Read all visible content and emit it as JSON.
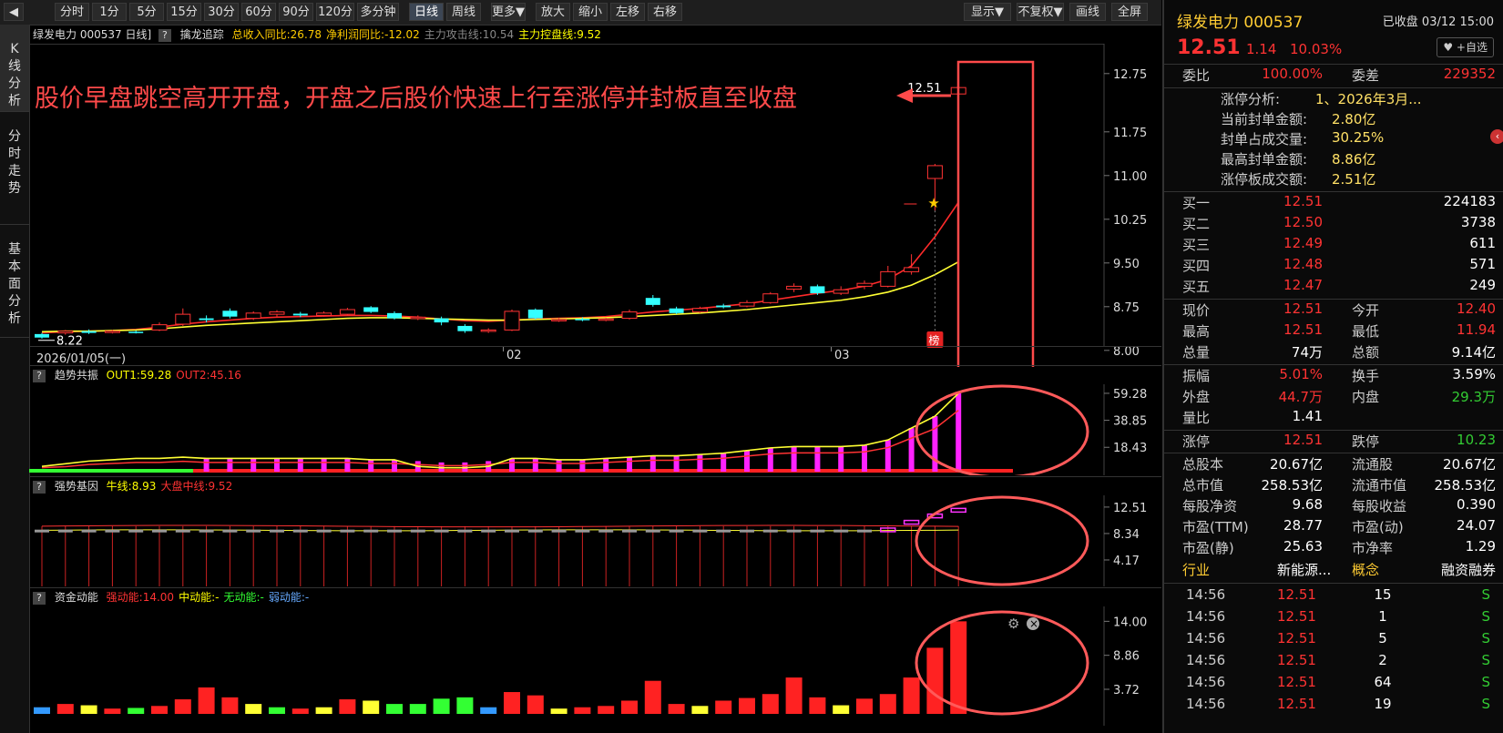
{
  "toolbar": {
    "collapse_label": "◀",
    "buttons": [
      "分时",
      "1分",
      "5分",
      "15分",
      "30分",
      "60分",
      "90分",
      "120分",
      "多分钟",
      "日线",
      "周线",
      "更多▼",
      "放大",
      "缩小",
      "左移",
      "右移"
    ],
    "active": "日线",
    "right_buttons": [
      "显示▼",
      "不复权▼",
      "画线",
      "全屏"
    ]
  },
  "left_tabs": [
    "K线分析",
    "分时走势",
    "基本面分析"
  ],
  "main_chart": {
    "title": "绿发电力 000537 日线]",
    "indicator_name": "擒龙追踪",
    "stats": [
      {
        "text": "总收入同比:26.78",
        "color": "#ffcc00"
      },
      {
        "text": "净利润同比:-12.02",
        "color": "#ffcc00"
      },
      {
        "text": "主力攻击线:10.54",
        "color": "#888888"
      },
      {
        "text": "主力控盘线:9.52",
        "color": "#ffff00"
      }
    ],
    "annotation": "股价早盘跳空高开开盘，开盘之后股价快速上行至涨停并封板直至收盘",
    "y_ticks": [
      "12.75",
      "11.75",
      "11.00",
      "10.25",
      "9.50",
      "8.75",
      "8.00"
    ],
    "date_labels": [
      "2026/01/05(一)",
      "02",
      "03"
    ],
    "low_label": "8.22",
    "high_label": "12.51",
    "badge": "榜"
  },
  "panel1": {
    "name": "趋势共振",
    "vals": [
      {
        "text": "OUT1:59.28",
        "color": "#ffff00"
      },
      {
        "text": "OUT2:45.16",
        "color": "#ff3333"
      }
    ],
    "y_ticks": [
      "59.28",
      "38.85",
      "18.43"
    ]
  },
  "panel2": {
    "name": "强势基因",
    "vals": [
      {
        "text": "牛线:8.93",
        "color": "#ffff00"
      },
      {
        "text": "大盘中线:9.52",
        "color": "#ff3333"
      }
    ],
    "y_ticks": [
      "12.51",
      "8.34",
      "4.17"
    ]
  },
  "panel3": {
    "name": "资金动能",
    "vals": [
      {
        "text": "强动能:14.00",
        "color": "#ff3333"
      },
      {
        "text": "中动能:-",
        "color": "#ffff00"
      },
      {
        "text": "无动能:-",
        "color": "#33ff33"
      },
      {
        "text": "弱动能:-",
        "color": "#66aaff"
      }
    ],
    "y_ticks": [
      "14.00",
      "8.86",
      "3.72"
    ]
  },
  "chart_data": {
    "type": "candlestick",
    "title": "绿发电力 000537 日线",
    "ylim": [
      8.0,
      12.9
    ],
    "candles": [
      {
        "o": 8.28,
        "c": 8.22,
        "h": 8.3,
        "l": 8.2
      },
      {
        "o": 8.3,
        "c": 8.33,
        "h": 8.35,
        "l": 8.27
      },
      {
        "o": 8.33,
        "c": 8.3,
        "h": 8.36,
        "l": 8.28
      },
      {
        "o": 8.32,
        "c": 8.33,
        "h": 8.35,
        "l": 8.29
      },
      {
        "o": 8.32,
        "c": 8.31,
        "h": 8.34,
        "l": 8.29
      },
      {
        "o": 8.35,
        "c": 8.44,
        "h": 8.48,
        "l": 8.33
      },
      {
        "o": 8.45,
        "c": 8.62,
        "h": 8.72,
        "l": 8.42
      },
      {
        "o": 8.55,
        "c": 8.52,
        "h": 8.6,
        "l": 8.48
      },
      {
        "o": 8.68,
        "c": 8.58,
        "h": 8.72,
        "l": 8.55
      },
      {
        "o": 8.55,
        "c": 8.64,
        "h": 8.67,
        "l": 8.52
      },
      {
        "o": 8.62,
        "c": 8.66,
        "h": 8.69,
        "l": 8.58
      },
      {
        "o": 8.63,
        "c": 8.6,
        "h": 8.66,
        "l": 8.57
      },
      {
        "o": 8.6,
        "c": 8.64,
        "h": 8.67,
        "l": 8.58
      },
      {
        "o": 8.62,
        "c": 8.7,
        "h": 8.73,
        "l": 8.6
      },
      {
        "o": 8.74,
        "c": 8.66,
        "h": 8.76,
        "l": 8.64
      },
      {
        "o": 8.64,
        "c": 8.55,
        "h": 8.67,
        "l": 8.53
      },
      {
        "o": 8.55,
        "c": 8.57,
        "h": 8.6,
        "l": 8.52
      },
      {
        "o": 8.55,
        "c": 8.48,
        "h": 8.58,
        "l": 8.43
      },
      {
        "o": 8.42,
        "c": 8.33,
        "h": 8.45,
        "l": 8.3
      },
      {
        "o": 8.35,
        "c": 8.35,
        "h": 8.38,
        "l": 8.3
      },
      {
        "o": 8.35,
        "c": 8.67,
        "h": 8.7,
        "l": 8.33
      },
      {
        "o": 8.7,
        "c": 8.55,
        "h": 8.72,
        "l": 8.53
      },
      {
        "o": 8.52,
        "c": 8.53,
        "h": 8.56,
        "l": 8.49
      },
      {
        "o": 8.54,
        "c": 8.52,
        "h": 8.57,
        "l": 8.5
      },
      {
        "o": 8.52,
        "c": 8.54,
        "h": 8.56,
        "l": 8.5
      },
      {
        "o": 8.55,
        "c": 8.66,
        "h": 8.7,
        "l": 8.53
      },
      {
        "o": 8.9,
        "c": 8.78,
        "h": 8.95,
        "l": 8.75
      },
      {
        "o": 8.72,
        "c": 8.64,
        "h": 8.75,
        "l": 8.62
      },
      {
        "o": 8.66,
        "c": 8.72,
        "h": 8.75,
        "l": 8.64
      },
      {
        "o": 8.77,
        "c": 8.74,
        "h": 8.8,
        "l": 8.72
      },
      {
        "o": 8.76,
        "c": 8.82,
        "h": 8.86,
        "l": 8.74
      },
      {
        "o": 8.82,
        "c": 8.97,
        "h": 9.0,
        "l": 8.8
      },
      {
        "o": 9.05,
        "c": 9.1,
        "h": 9.15,
        "l": 9.0
      },
      {
        "o": 9.1,
        "c": 8.98,
        "h": 9.13,
        "l": 8.95
      },
      {
        "o": 8.98,
        "c": 9.04,
        "h": 9.1,
        "l": 8.95
      },
      {
        "o": 9.1,
        "c": 9.15,
        "h": 9.2,
        "l": 9.05
      },
      {
        "o": 9.1,
        "c": 9.35,
        "h": 9.45,
        "l": 9.08
      },
      {
        "o": 9.35,
        "c": 9.42,
        "h": 9.65,
        "l": 9.3
      },
      {
        "o": 10.95,
        "c": 11.17,
        "h": 11.2,
        "l": 10.4
      },
      {
        "o": 12.4,
        "c": 12.51,
        "h": 12.51,
        "l": 11.94
      }
    ],
    "ma_yellow": [
      8.32,
      8.33,
      8.33,
      8.34,
      8.35,
      8.37,
      8.4,
      8.43,
      8.45,
      8.47,
      8.49,
      8.51,
      8.53,
      8.55,
      8.56,
      8.56,
      8.55,
      8.54,
      8.53,
      8.52,
      8.52,
      8.53,
      8.54,
      8.55,
      8.56,
      8.58,
      8.6,
      8.62,
      8.64,
      8.67,
      8.7,
      8.74,
      8.78,
      8.82,
      8.86,
      8.92,
      9.0,
      9.12,
      9.3,
      9.52
    ],
    "ma_red": [
      8.3,
      8.32,
      8.33,
      8.34,
      8.36,
      8.4,
      8.45,
      8.49,
      8.52,
      8.55,
      8.57,
      8.58,
      8.59,
      8.6,
      8.6,
      8.59,
      8.57,
      8.54,
      8.51,
      8.5,
      8.52,
      8.54,
      8.55,
      8.56,
      8.58,
      8.62,
      8.66,
      8.69,
      8.72,
      8.76,
      8.8,
      8.86,
      8.92,
      8.98,
      9.03,
      9.1,
      9.22,
      9.45,
      9.95,
      10.54
    ],
    "p1_bars": [
      4,
      6,
      8,
      9,
      10,
      10,
      11,
      10,
      10,
      10,
      10,
      10,
      10,
      10,
      9,
      9,
      8,
      7,
      7,
      8,
      10,
      10,
      9,
      9,
      10,
      11,
      12,
      12,
      13,
      14,
      16,
      18,
      19,
      19,
      19,
      20,
      24,
      33,
      42,
      59.28
    ],
    "p3_bars": [
      1.0,
      1.5,
      1.3,
      0.8,
      0.9,
      1.2,
      2.2,
      4.0,
      2.5,
      1.5,
      1.0,
      0.8,
      1.0,
      2.2,
      2.0,
      1.5,
      1.5,
      2.3,
      2.5,
      1.0,
      3.3,
      2.8,
      0.8,
      1.0,
      1.2,
      2.0,
      5.0,
      1.5,
      1.2,
      2.0,
      2.4,
      3.0,
      5.5,
      2.5,
      1.3,
      2.3,
      3.0,
      5.5,
      10.0,
      14.0
    ]
  },
  "right_panel": {
    "title": "绿发电力 000537",
    "status": "已收盘 03/12 15:00",
    "price": "12.51",
    "change": "1.14",
    "pct": "10.03%",
    "fav": "♥ +自选",
    "weibi_l": "委比",
    "weibi_v": "100.00%",
    "weicha_l": "委差",
    "weicha_v": "229352",
    "limit_analysis": [
      {
        "l": "涨停分析:",
        "v": "1、2026年3月..."
      },
      {
        "l": "当前封单金额:",
        "v": "2.80亿"
      },
      {
        "l": "封单占成交量:",
        "v": "30.25%"
      },
      {
        "l": "最高封单金额:",
        "v": "8.86亿"
      },
      {
        "l": "涨停板成交额:",
        "v": "2.51亿"
      }
    ],
    "buys": [
      {
        "l": "买一",
        "p": "12.51",
        "v": "224183"
      },
      {
        "l": "买二",
        "p": "12.50",
        "v": "3738"
      },
      {
        "l": "买三",
        "p": "12.49",
        "v": "611"
      },
      {
        "l": "买四",
        "p": "12.48",
        "v": "571"
      },
      {
        "l": "买五",
        "p": "12.47",
        "v": "249"
      }
    ],
    "quote": [
      [
        {
          "l": "现价",
          "v": "12.51",
          "c": "red"
        },
        {
          "l": "今开",
          "v": "12.40",
          "c": "red"
        }
      ],
      [
        {
          "l": "最高",
          "v": "12.51",
          "c": "red"
        },
        {
          "l": "最低",
          "v": "11.94",
          "c": "red"
        }
      ],
      [
        {
          "l": "总量",
          "v": "74万",
          "c": "white"
        },
        {
          "l": "总额",
          "v": "9.14亿",
          "c": "white"
        }
      ]
    ],
    "quote2": [
      [
        {
          "l": "振幅",
          "v": "5.01%",
          "c": "red"
        },
        {
          "l": "换手",
          "v": "3.59%",
          "c": "white"
        }
      ],
      [
        {
          "l": "外盘",
          "v": "44.7万",
          "c": "red"
        },
        {
          "l": "内盘",
          "v": "29.3万",
          "c": "green"
        }
      ],
      [
        {
          "l": "量比",
          "v": "1.41",
          "c": "white"
        },
        {
          "l": "",
          "v": "",
          "c": "white"
        }
      ]
    ],
    "limits": [
      {
        "l": "涨停",
        "v": "12.51",
        "c": "red"
      },
      {
        "l": "跌停",
        "v": "10.23",
        "c": "green"
      }
    ],
    "fund": [
      [
        {
          "l": "总股本",
          "v": "20.67亿"
        },
        {
          "l": "流通股",
          "v": "20.67亿"
        }
      ],
      [
        {
          "l": "总市值",
          "v": "258.53亿"
        },
        {
          "l": "流通市值",
          "v": "258.53亿"
        }
      ],
      [
        {
          "l": "每股净资",
          "v": "9.68"
        },
        {
          "l": "每股收益",
          "v": "0.390"
        }
      ],
      [
        {
          "l": "市盈(TTM)",
          "v": "28.77"
        },
        {
          "l": "市盈(动)",
          "v": "24.07"
        }
      ],
      [
        {
          "l": "市盈(静)",
          "v": "25.63"
        },
        {
          "l": "市净率",
          "v": "1.29"
        }
      ]
    ],
    "industry": {
      "l1": "行业",
      "v1": "新能源...",
      "l2": "概念",
      "v2": "融资融券"
    },
    "ticks": [
      {
        "t": "14:56",
        "p": "12.51",
        "v": "15",
        "s": "S"
      },
      {
        "t": "14:56",
        "p": "12.51",
        "v": "1",
        "s": "S"
      },
      {
        "t": "14:56",
        "p": "12.51",
        "v": "5",
        "s": "S"
      },
      {
        "t": "14:56",
        "p": "12.51",
        "v": "2",
        "s": "S"
      },
      {
        "t": "14:56",
        "p": "12.51",
        "v": "64",
        "s": "S"
      },
      {
        "t": "14:56",
        "p": "12.51",
        "v": "19",
        "s": "S"
      }
    ]
  }
}
